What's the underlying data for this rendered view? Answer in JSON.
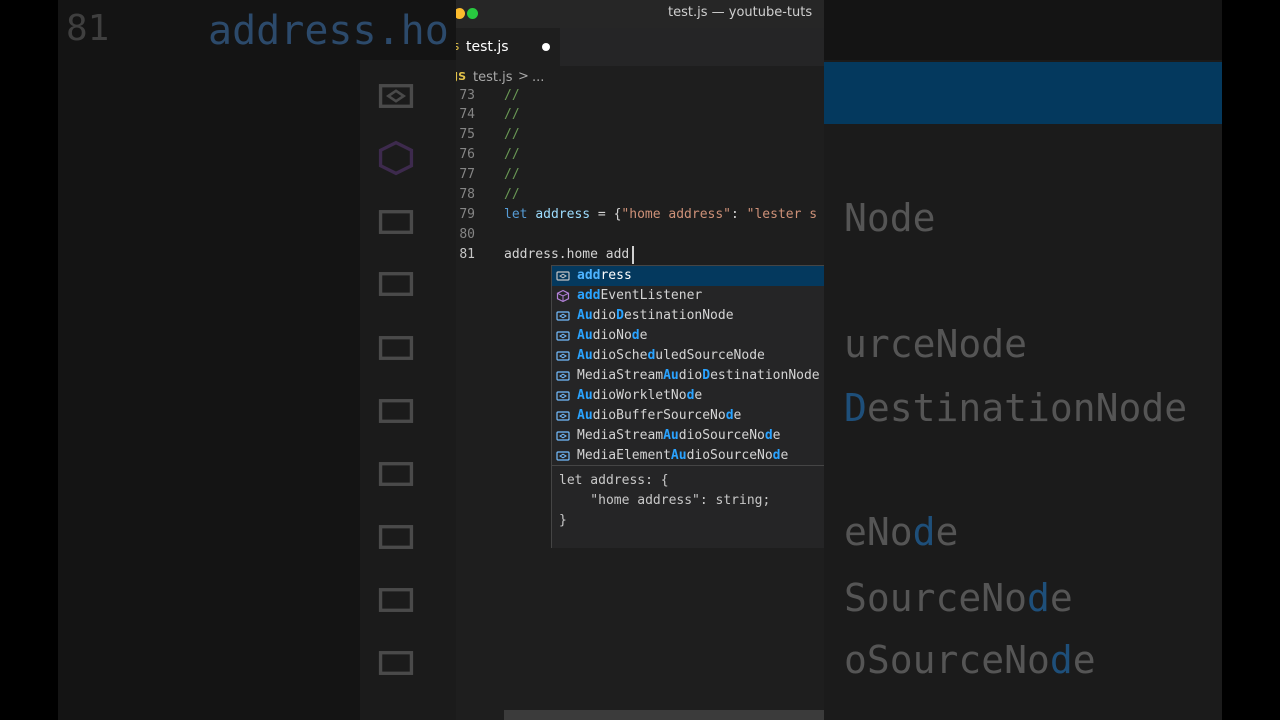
{
  "window": {
    "title": "test.js — youtube-tuts"
  },
  "tab": {
    "label": "test.js",
    "icon": "js"
  },
  "breadcrumb": {
    "icon": "JS",
    "file": "test.js",
    "separator": ">",
    "more": "..."
  },
  "lines": [
    {
      "num": "73",
      "text": "//"
    },
    {
      "num": "74",
      "text": "//"
    },
    {
      "num": "75",
      "text": "//"
    },
    {
      "num": "76",
      "text": "//"
    },
    {
      "num": "77",
      "text": "//"
    },
    {
      "num": "78",
      "text": "//"
    },
    {
      "num": "79",
      "kw": "let",
      "var": "address",
      "eq": " = {",
      "str1": "\"home address\"",
      "colon": ": ",
      "str2": "\"lester s"
    },
    {
      "num": "80",
      "text": ""
    },
    {
      "num": "81",
      "text": "address.home add"
    }
  ],
  "suggestions": [
    {
      "icon": "variable-icon",
      "pre": "",
      "match": "add",
      "post": "ress",
      "selected": true
    },
    {
      "icon": "method-icon",
      "pre": "",
      "match": "add",
      "post": "EventListener"
    },
    {
      "icon": "variable-icon",
      "pre": "",
      "match": "Au",
      "post": "dio",
      "match2": "D",
      "post2": "estinationNode"
    },
    {
      "icon": "variable-icon",
      "pre": "",
      "match": "Au",
      "post": "dioNo",
      "match2": "d",
      "post2": "e"
    },
    {
      "icon": "variable-icon",
      "pre": "",
      "match": "Au",
      "post": "dioSche",
      "match2": "d",
      "post2": "uledSourceNode"
    },
    {
      "icon": "variable-icon",
      "pre": "MediaStream",
      "match": "A",
      "post": "u",
      "match2": "D",
      "post2": "estinationNode",
      "mid": "dio"
    },
    {
      "icon": "variable-icon",
      "pre": "",
      "match": "Au",
      "post": "dioWorkletNo",
      "match2": "d",
      "post2": "e"
    },
    {
      "icon": "variable-icon",
      "pre": "",
      "match": "Au",
      "post": "dioBufferSourceNo",
      "match2": "d",
      "post2": "e"
    },
    {
      "icon": "variable-icon",
      "pre": "MediaStream",
      "match": "A",
      "post": "u",
      "mid": "dioSourceNo",
      "match2": "d",
      "post2": "e"
    },
    {
      "icon": "variable-icon",
      "pre": "MediaElement",
      "match": "A",
      "post": "u",
      "mid": "dioSourceNo",
      "match2": "d",
      "post2": "e"
    }
  ],
  "details": {
    "line1": "let address: {",
    "line2": "    \"home address\": string;",
    "line3": "}"
  },
  "background": {
    "left_line_number": "81",
    "left_code": "address.ho",
    "right_words": [
      {
        "text": "Node",
        "hl": ""
      },
      {
        "text": "urceNode",
        "hl": ""
      },
      {
        "text": "DestinationNode",
        "hl": "D"
      },
      {
        "text": "eNode",
        "hl": "d"
      },
      {
        "text": "SourceNode",
        "hl": "d"
      },
      {
        "text": "oSourceNode",
        "hl": "d"
      }
    ]
  },
  "colors": {
    "accent": "#04395e",
    "comment": "#6a9955",
    "keyword": "#569cd6",
    "string": "#ce9178",
    "match": "#2aa3ff"
  }
}
